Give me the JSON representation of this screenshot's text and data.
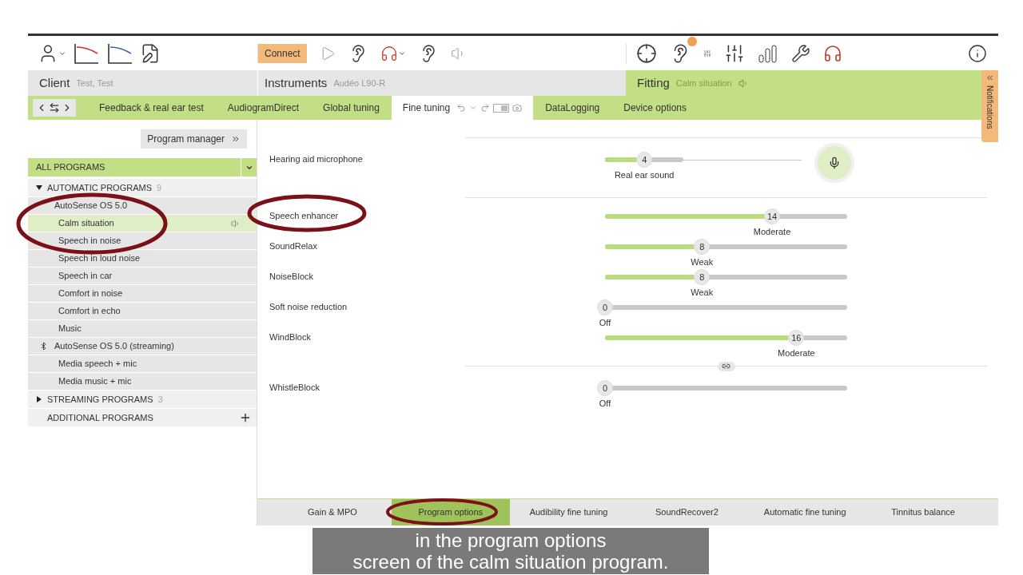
{
  "toolbar": {
    "connect": "Connect",
    "alert_badge": true
  },
  "sections": {
    "client": {
      "title": "Client",
      "value": "Test, Test"
    },
    "instruments": {
      "title": "Instruments",
      "value": "Audéo L90-R"
    },
    "fitting": {
      "title": "Fitting",
      "value": "Calm situation"
    }
  },
  "nav_tabs": [
    {
      "label": "Feedback & real ear test",
      "selected": false
    },
    {
      "label": "AudiogramDirect",
      "selected": false
    },
    {
      "label": "Global tuning",
      "selected": false
    },
    {
      "label": "Fine tuning",
      "selected": true
    },
    {
      "label": "DataLogging",
      "selected": false
    },
    {
      "label": "Device options",
      "selected": false
    }
  ],
  "notifications": {
    "label": "Notifications"
  },
  "sidebar": {
    "program_manager": "Program manager",
    "filter": "ALL PROGRAMS",
    "groups": [
      {
        "label": "AUTOMATIC PROGRAMS",
        "count": "9",
        "expanded": true,
        "children": [
          {
            "label": "AutoSense OS 5.0",
            "kind": "family",
            "children": [
              {
                "label": "Calm situation",
                "selected": true
              },
              {
                "label": "Speech in noise",
                "selected": false
              },
              {
                "label": "Speech in loud noise",
                "selected": false
              },
              {
                "label": "Speech in car",
                "selected": false
              },
              {
                "label": "Comfort in noise",
                "selected": false
              },
              {
                "label": "Comfort in echo",
                "selected": false
              },
              {
                "label": "Music",
                "selected": false
              }
            ]
          },
          {
            "label": "AutoSense OS 5.0 (streaming)",
            "kind": "streaming",
            "children": [
              {
                "label": "Media speech + mic",
                "selected": false
              },
              {
                "label": "Media music + mic",
                "selected": false
              }
            ]
          }
        ]
      },
      {
        "label": "STREAMING PROGRAMS",
        "count": "3",
        "expanded": false
      },
      {
        "label": "ADDITIONAL PROGRAMS",
        "addable": true
      }
    ]
  },
  "settings": [
    {
      "rows": [
        {
          "label": "Hearing aid microphone",
          "kind": "mic",
          "value": "4",
          "caption": "Real ear sound",
          "level": 0.2
        }
      ]
    },
    {
      "rows": [
        {
          "label": "Speech enhancer",
          "kind": "slider",
          "value": "14",
          "caption": "Moderate",
          "level": 0.69
        },
        {
          "label": "SoundRelax",
          "kind": "slider",
          "value": "8",
          "caption": "Weak",
          "level": 0.4
        },
        {
          "label": "NoiseBlock",
          "kind": "slider",
          "value": "8",
          "caption": "Weak",
          "level": 0.4
        },
        {
          "label": "Soft noise reduction",
          "kind": "slider",
          "value": "0",
          "caption": "Off",
          "level": 0
        },
        {
          "label": "WindBlock",
          "kind": "slider",
          "value": "16",
          "caption": "Moderate",
          "level": 0.79
        }
      ]
    },
    {
      "linked": true,
      "rows": [
        {
          "label": "WhistleBlock",
          "kind": "slider",
          "value": "0",
          "caption": "Off",
          "level": 0
        }
      ]
    }
  ],
  "bottom_tabs": [
    {
      "label": "Gain & MPO",
      "selected": false
    },
    {
      "label": "Program options",
      "selected": true
    },
    {
      "label": "Audibility fine tuning",
      "selected": false
    },
    {
      "label": "SoundRecover2",
      "selected": false
    },
    {
      "label": "Automatic fine tuning",
      "selected": false
    },
    {
      "label": "Tinnitus balance",
      "selected": false
    }
  ],
  "caption": [
    "in the program options",
    "screen of the calm situation program."
  ]
}
